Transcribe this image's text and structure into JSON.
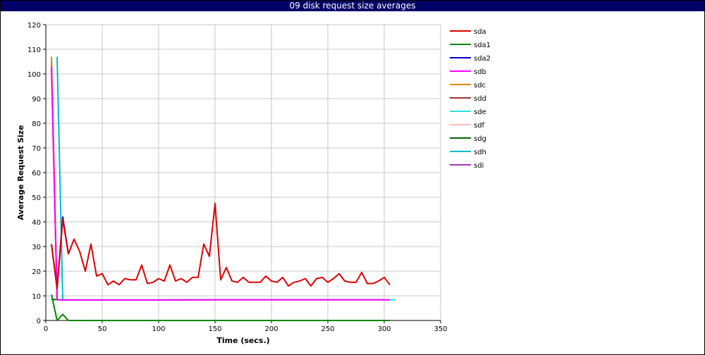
{
  "chart_data": {
    "type": "line",
    "title": "09 disk request size averages",
    "xlabel": "Time (secs.)",
    "ylabel": "Average Request Size",
    "xlim": [
      0,
      350
    ],
    "ylim": [
      0,
      120
    ],
    "xticks": [
      0,
      50,
      100,
      150,
      200,
      250,
      300,
      350
    ],
    "yticks": [
      0,
      10,
      20,
      30,
      40,
      50,
      60,
      70,
      80,
      90,
      100,
      110,
      120
    ],
    "grid": true,
    "legend_position": "right",
    "series": [
      {
        "name": "sda",
        "color": "#dd0000",
        "x": [
          5,
          10,
          15,
          20,
          25,
          30,
          35,
          40,
          45,
          50,
          55,
          60,
          65,
          70,
          75,
          80,
          85,
          90,
          95,
          100,
          105,
          110,
          115,
          120,
          125,
          130,
          135,
          140,
          145,
          150,
          155,
          160,
          165,
          170,
          175,
          180,
          185,
          190,
          195,
          200,
          205,
          210,
          215,
          220,
          225,
          230,
          235,
          240,
          245,
          250,
          255,
          260,
          265,
          270,
          275,
          280,
          285,
          290,
          295,
          300,
          305
        ],
        "y": [
          31,
          13,
          41,
          27,
          33,
          28,
          20,
          31,
          18,
          19,
          14.5,
          16,
          14.5,
          17,
          16.5,
          16.5,
          22.5,
          15,
          15.5,
          17,
          16,
          22.5,
          16,
          17,
          15.5,
          17.5,
          17.5,
          31,
          26,
          47.5,
          16.5,
          21.5,
          16,
          15.5,
          17.5,
          15.5,
          15.5,
          15.5,
          18,
          16,
          15.5,
          17.5,
          14,
          15.5,
          16,
          17,
          14,
          17,
          17.5,
          15.5,
          17,
          19,
          16,
          15.5,
          15.5,
          19.5,
          15,
          15,
          16,
          17.5,
          14.5
        ]
      },
      {
        "name": "sda1",
        "color": "#008800",
        "x": [
          5,
          10,
          15,
          20,
          25,
          30,
          35,
          40,
          45,
          50,
          55,
          60,
          65,
          70,
          75,
          80,
          85,
          90,
          95,
          100,
          105,
          110,
          115,
          120,
          125,
          130,
          135,
          140,
          145,
          150,
          155,
          160,
          165,
          170,
          175,
          180,
          185,
          190,
          195,
          200,
          205,
          210,
          215,
          220,
          225,
          230,
          235,
          240,
          245,
          250,
          255,
          260,
          265,
          270,
          275,
          280,
          285,
          290,
          295,
          300,
          305
        ],
        "y": [
          10.5,
          0,
          2.5,
          0,
          0,
          0,
          0,
          0,
          0,
          0,
          0,
          0,
          0,
          0,
          0,
          0,
          0,
          0,
          0,
          0,
          0,
          0,
          0,
          0,
          0,
          0,
          0,
          0,
          0,
          0,
          0,
          0,
          0,
          0,
          0,
          0,
          0,
          0,
          0,
          0,
          0,
          0,
          0,
          0,
          0,
          0,
          0,
          0,
          0,
          0,
          0,
          0,
          0,
          0,
          0,
          0,
          0,
          0,
          0,
          0,
          0
        ]
      },
      {
        "name": "sda2",
        "color": "#0000cc",
        "x": [
          5,
          10,
          15,
          20
        ],
        "y": [
          31,
          13,
          42,
          27
        ]
      },
      {
        "name": "sdb",
        "color": "#ff00ff",
        "x": [
          5,
          10,
          15,
          50,
          100,
          150,
          200,
          250,
          300,
          305
        ],
        "y": [
          103,
          8.5,
          8.3,
          8.3,
          8.3,
          8.4,
          8.4,
          8.4,
          8.4,
          8.4
        ]
      },
      {
        "name": "sdc",
        "color": "#dd8800",
        "x": [
          5,
          10
        ],
        "y": [
          107,
          8.5
        ]
      },
      {
        "name": "sdd",
        "color": "#993333",
        "x": [
          5,
          10
        ],
        "y": [
          105,
          8.5
        ]
      },
      {
        "name": "sde",
        "color": "#33dddd",
        "x": [
          300,
          305,
          310
        ],
        "y": [
          8.4,
          8.4,
          8.4
        ]
      },
      {
        "name": "sdf",
        "color": "#ffbbbb",
        "x": [
          5,
          10
        ],
        "y": [
          100,
          8.5
        ]
      },
      {
        "name": "sdg",
        "color": "#006600",
        "x": [
          5,
          10
        ],
        "y": [
          8.5,
          8.5
        ]
      },
      {
        "name": "sdh",
        "color": "#00bbcc",
        "x": [
          10,
          15,
          20,
          50,
          100,
          150,
          200,
          250,
          300,
          310
        ],
        "y": [
          107,
          8.5,
          8.3,
          8.3,
          8.3,
          8.4,
          8.4,
          8.4,
          8.4,
          8.4
        ]
      },
      {
        "name": "sdi",
        "color": "#aa33bb",
        "x": [
          5,
          10,
          15,
          50,
          100,
          150,
          200,
          250,
          300,
          305
        ],
        "y": [
          102,
          8.4,
          8.3,
          8.3,
          8.3,
          8.4,
          8.4,
          8.4,
          8.4,
          8.4
        ]
      }
    ]
  }
}
